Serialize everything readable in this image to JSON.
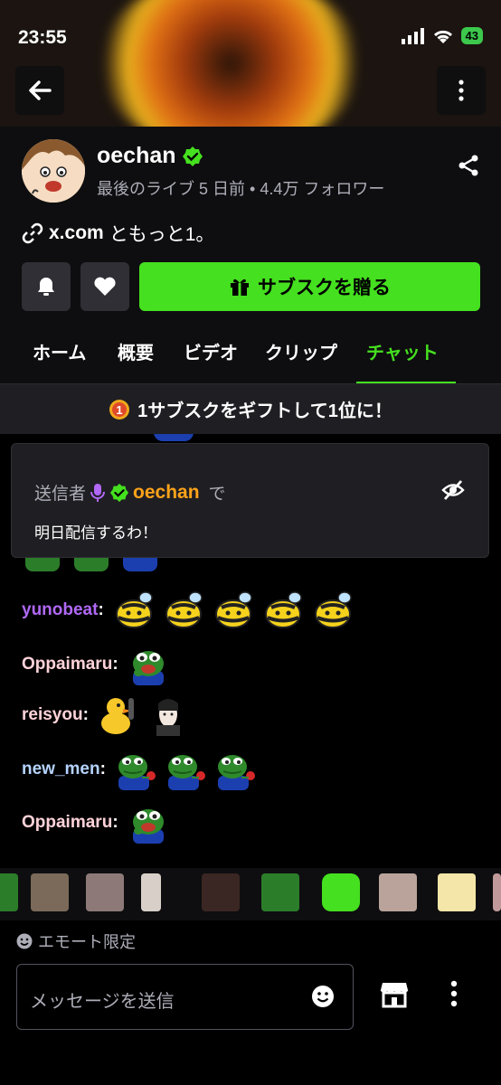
{
  "status_bar": {
    "time": "23:55",
    "battery": "43"
  },
  "channel": {
    "name": "oechan",
    "meta": "最後のライブ 5 日前 • 4.4万 フォロワー",
    "link_host": "x.com",
    "link_text": "ともっと1。"
  },
  "actions": {
    "gift_label": "サブスクを贈る"
  },
  "tabs": [
    "ホーム",
    "概要",
    "ビデオ",
    "クリップ",
    "チャット"
  ],
  "active_tab": "チャット",
  "gift_banner": "1サブスクをギフトして1位に！",
  "pinned": {
    "prefix": "送信者",
    "name": "oechan",
    "suffix": "で",
    "message": "明日配信するわ！"
  },
  "chat": [
    {
      "user": "yunobeat",
      "color": "#b068f5",
      "emotes": [
        "bee",
        "bee",
        "bee",
        "bee",
        "bee"
      ]
    },
    {
      "user": "Oppaimaru",
      "color": "#ffd3d9",
      "emotes": [
        "pepe-laugh"
      ]
    },
    {
      "user": "reisyou",
      "color": "#ffd3d9",
      "emotes": [
        "duck",
        "face"
      ]
    },
    {
      "user": "new_men",
      "color": "#b5d3ff",
      "emotes": [
        "pepe-rose",
        "pepe-rose",
        "pepe-rose"
      ]
    },
    {
      "user": "Oppaimaru",
      "color": "#ffd3d9",
      "emotes": [
        "pepe-laugh"
      ]
    }
  ],
  "composer": {
    "emote_only": "エモート限定",
    "placeholder": "メッセージを送信"
  },
  "colors": {
    "accent": "#45e01f",
    "pinned_name": "#ffa31a",
    "verified": "#45e01f"
  }
}
